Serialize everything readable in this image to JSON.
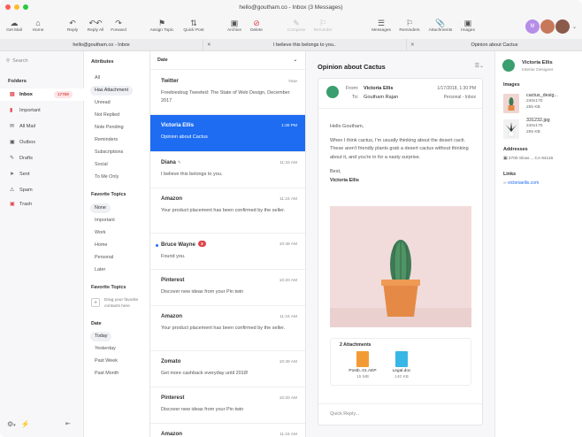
{
  "window": {
    "title": "hello@goutham.co - Inbox (3 Messages)"
  },
  "toolbar": {
    "get_mail": "Get Mail",
    "home": "Home",
    "reply": "Reply",
    "reply_all": "Reply All",
    "forward": "Forward",
    "assign_topic": "Assign Topic",
    "quick_post": "Quick Post",
    "archive": "Archive",
    "delete": "Delete",
    "compose": "Compose",
    "reminder": "Reminder",
    "messages": "Messages",
    "reminders": "Reminders",
    "attachments": "Attachments",
    "images": "Images",
    "avatar_initial": "M"
  },
  "tabs": [
    "hello@goutham.co - Inbox",
    "I believe this belongs to you..",
    "Opinion about Cactus"
  ],
  "sidebar": {
    "search_placeholder": "Search",
    "folders_heading": "Folders",
    "folders": [
      {
        "label": "Inbox",
        "icon": "inbox-icon",
        "badge": "17769"
      },
      {
        "label": "Important",
        "icon": "bookmark-icon"
      },
      {
        "label": "All Mail",
        "icon": "mail-icon"
      },
      {
        "label": "Outbox",
        "icon": "outbox-icon"
      },
      {
        "label": "Drafts",
        "icon": "pencil-icon"
      },
      {
        "label": "Sent",
        "icon": "send-icon"
      },
      {
        "label": "Spam",
        "icon": "spam-icon"
      },
      {
        "label": "Trash",
        "icon": "trash-icon"
      }
    ]
  },
  "filters": {
    "attributes_heading": "Attributes",
    "attributes": [
      "All",
      "Has Attachment",
      "Unread",
      "Not Replied",
      "Note Pending",
      "Reminders",
      "Subscriptions",
      "Social",
      "To Me Only"
    ],
    "topics_heading": "Favorite Topics",
    "topics": [
      "None",
      "Important",
      "Work",
      "Home",
      "Personal",
      "Later"
    ],
    "topics2_heading": "Favorite Topics",
    "drag_text": "Drag your favorite contacts here",
    "date_heading": "Date",
    "dates": [
      "Today",
      "Yesterday",
      "Past Week",
      "Past Month"
    ]
  },
  "list": {
    "header": "Date",
    "messages": [
      {
        "from": "Twitter",
        "time": "Now",
        "body": "Freebiesbug Tweeted: The State of Web Design, December 2017"
      },
      {
        "from": "Victoria Ellis",
        "time": "1:30 PM",
        "body": "Opinion about Cactus"
      },
      {
        "from": "Diana",
        "time": "11:33 AM",
        "body": "I believe this belongs to you."
      },
      {
        "from": "Amazon",
        "time": "11:24 AM",
        "body": "Your product placement has been confirmed by the seller."
      },
      {
        "from": "Bruce Wayne",
        "time": "10:49 AM",
        "body": "Found you.",
        "count": "3"
      },
      {
        "from": "Pinterest",
        "time": "10:20 AM",
        "body": "Discover new ideas from your Pin twin"
      },
      {
        "from": "Amazon",
        "time": "11:24 AM",
        "body": "Your product placement has been confirmed by the seller."
      },
      {
        "from": "Zomato",
        "time": "10:49 AM",
        "body": "Get more cashback everyday until 2018!"
      },
      {
        "from": "Pinterest",
        "time": "10:20 AM",
        "body": "Discover new ideas from your Pin twin"
      },
      {
        "from": "Amazon",
        "time": "11:24 AM",
        "body": ""
      }
    ]
  },
  "reader": {
    "subject": "Opinion about Cactus",
    "from_label": "From:",
    "from_name": "Victoria Ellis",
    "to_label": "To:",
    "to_name": "Goutham Rajan",
    "date": "1/17/2018, 1:30 PM",
    "folder": "Personal - Inbox",
    "greeting": "Hello Goutham,",
    "body": "When I think cactus, I'm usually thinking about the desert cacti. These aren't friendly plants grab a desert cactus without thinking about it, and you're in for a nasty surprise.",
    "signoff": "Best,",
    "signature": "Victoria Ellis",
    "attachments_heading": "2 Attachments",
    "attachments": [
      {
        "name": "Postb..01.AEP",
        "size": "15 MB",
        "icon": "ae-file-icon",
        "color": "#f29b34"
      },
      {
        "name": "Legal.doc",
        "size": "140 KB",
        "icon": "doc-file-icon",
        "color": "#38b6e6"
      }
    ],
    "quick_reply": "Quick Reply..."
  },
  "contact": {
    "name": "Victoria Ellis",
    "title": "Interior Designer",
    "images_heading": "Images",
    "images": [
      {
        "name": "cactus_desig...",
        "dims": "240x170",
        "size": "255 KB"
      },
      {
        "name": "331232.jpg",
        "dims": "240x170",
        "size": "255 KB"
      }
    ],
    "addresses_heading": "Addresses",
    "address": "2700 Sloat..., CA 94116",
    "links_heading": "Links",
    "link": "victoriaellis.com"
  },
  "colors": {
    "accent": "#1d6cf2",
    "danger": "#e0434b"
  }
}
